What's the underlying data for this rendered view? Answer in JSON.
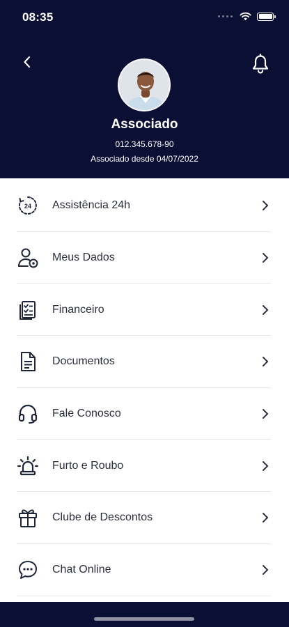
{
  "status_bar": {
    "time": "08:35"
  },
  "header": {
    "profile_name": "Associado",
    "profile_id": "012.345.678-90",
    "member_since": "Associado desde 04/07/2022"
  },
  "menu": {
    "items": [
      {
        "label": "Assistência 24h",
        "icon": "24h-clock-icon"
      },
      {
        "label": "Meus Dados",
        "icon": "user-settings-icon"
      },
      {
        "label": "Financeiro",
        "icon": "invoice-checklist-icon"
      },
      {
        "label": "Documentos",
        "icon": "document-icon"
      },
      {
        "label": "Fale Conosco",
        "icon": "headset-icon"
      },
      {
        "label": "Furto e Roubo",
        "icon": "siren-icon"
      },
      {
        "label": "Clube de Descontos",
        "icon": "gift-icon"
      },
      {
        "label": "Chat Online",
        "icon": "chat-bubble-icon"
      }
    ]
  },
  "colors": {
    "header_bg": "#0b0f33",
    "text": "#2b2f3c",
    "divider": "#e6e7ea"
  }
}
